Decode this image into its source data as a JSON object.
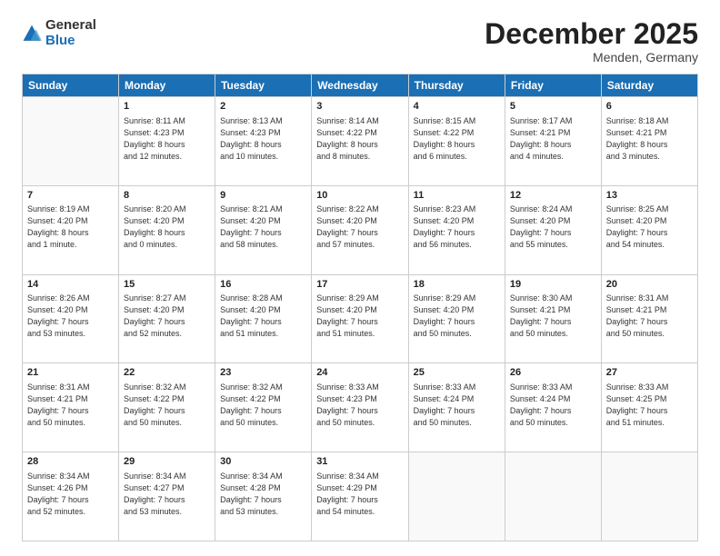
{
  "logo": {
    "general": "General",
    "blue": "Blue"
  },
  "header": {
    "month": "December 2025",
    "location": "Menden, Germany"
  },
  "weekdays": [
    "Sunday",
    "Monday",
    "Tuesday",
    "Wednesday",
    "Thursday",
    "Friday",
    "Saturday"
  ],
  "weeks": [
    [
      {
        "day": "",
        "info": ""
      },
      {
        "day": "1",
        "info": "Sunrise: 8:11 AM\nSunset: 4:23 PM\nDaylight: 8 hours\nand 12 minutes."
      },
      {
        "day": "2",
        "info": "Sunrise: 8:13 AM\nSunset: 4:23 PM\nDaylight: 8 hours\nand 10 minutes."
      },
      {
        "day": "3",
        "info": "Sunrise: 8:14 AM\nSunset: 4:22 PM\nDaylight: 8 hours\nand 8 minutes."
      },
      {
        "day": "4",
        "info": "Sunrise: 8:15 AM\nSunset: 4:22 PM\nDaylight: 8 hours\nand 6 minutes."
      },
      {
        "day": "5",
        "info": "Sunrise: 8:17 AM\nSunset: 4:21 PM\nDaylight: 8 hours\nand 4 minutes."
      },
      {
        "day": "6",
        "info": "Sunrise: 8:18 AM\nSunset: 4:21 PM\nDaylight: 8 hours\nand 3 minutes."
      }
    ],
    [
      {
        "day": "7",
        "info": "Sunrise: 8:19 AM\nSunset: 4:20 PM\nDaylight: 8 hours\nand 1 minute."
      },
      {
        "day": "8",
        "info": "Sunrise: 8:20 AM\nSunset: 4:20 PM\nDaylight: 8 hours\nand 0 minutes."
      },
      {
        "day": "9",
        "info": "Sunrise: 8:21 AM\nSunset: 4:20 PM\nDaylight: 7 hours\nand 58 minutes."
      },
      {
        "day": "10",
        "info": "Sunrise: 8:22 AM\nSunset: 4:20 PM\nDaylight: 7 hours\nand 57 minutes."
      },
      {
        "day": "11",
        "info": "Sunrise: 8:23 AM\nSunset: 4:20 PM\nDaylight: 7 hours\nand 56 minutes."
      },
      {
        "day": "12",
        "info": "Sunrise: 8:24 AM\nSunset: 4:20 PM\nDaylight: 7 hours\nand 55 minutes."
      },
      {
        "day": "13",
        "info": "Sunrise: 8:25 AM\nSunset: 4:20 PM\nDaylight: 7 hours\nand 54 minutes."
      }
    ],
    [
      {
        "day": "14",
        "info": "Sunrise: 8:26 AM\nSunset: 4:20 PM\nDaylight: 7 hours\nand 53 minutes."
      },
      {
        "day": "15",
        "info": "Sunrise: 8:27 AM\nSunset: 4:20 PM\nDaylight: 7 hours\nand 52 minutes."
      },
      {
        "day": "16",
        "info": "Sunrise: 8:28 AM\nSunset: 4:20 PM\nDaylight: 7 hours\nand 51 minutes."
      },
      {
        "day": "17",
        "info": "Sunrise: 8:29 AM\nSunset: 4:20 PM\nDaylight: 7 hours\nand 51 minutes."
      },
      {
        "day": "18",
        "info": "Sunrise: 8:29 AM\nSunset: 4:20 PM\nDaylight: 7 hours\nand 50 minutes."
      },
      {
        "day": "19",
        "info": "Sunrise: 8:30 AM\nSunset: 4:21 PM\nDaylight: 7 hours\nand 50 minutes."
      },
      {
        "day": "20",
        "info": "Sunrise: 8:31 AM\nSunset: 4:21 PM\nDaylight: 7 hours\nand 50 minutes."
      }
    ],
    [
      {
        "day": "21",
        "info": "Sunrise: 8:31 AM\nSunset: 4:21 PM\nDaylight: 7 hours\nand 50 minutes."
      },
      {
        "day": "22",
        "info": "Sunrise: 8:32 AM\nSunset: 4:22 PM\nDaylight: 7 hours\nand 50 minutes."
      },
      {
        "day": "23",
        "info": "Sunrise: 8:32 AM\nSunset: 4:22 PM\nDaylight: 7 hours\nand 50 minutes."
      },
      {
        "day": "24",
        "info": "Sunrise: 8:33 AM\nSunset: 4:23 PM\nDaylight: 7 hours\nand 50 minutes."
      },
      {
        "day": "25",
        "info": "Sunrise: 8:33 AM\nSunset: 4:24 PM\nDaylight: 7 hours\nand 50 minutes."
      },
      {
        "day": "26",
        "info": "Sunrise: 8:33 AM\nSunset: 4:24 PM\nDaylight: 7 hours\nand 50 minutes."
      },
      {
        "day": "27",
        "info": "Sunrise: 8:33 AM\nSunset: 4:25 PM\nDaylight: 7 hours\nand 51 minutes."
      }
    ],
    [
      {
        "day": "28",
        "info": "Sunrise: 8:34 AM\nSunset: 4:26 PM\nDaylight: 7 hours\nand 52 minutes."
      },
      {
        "day": "29",
        "info": "Sunrise: 8:34 AM\nSunset: 4:27 PM\nDaylight: 7 hours\nand 53 minutes."
      },
      {
        "day": "30",
        "info": "Sunrise: 8:34 AM\nSunset: 4:28 PM\nDaylight: 7 hours\nand 53 minutes."
      },
      {
        "day": "31",
        "info": "Sunrise: 8:34 AM\nSunset: 4:29 PM\nDaylight: 7 hours\nand 54 minutes."
      },
      {
        "day": "",
        "info": ""
      },
      {
        "day": "",
        "info": ""
      },
      {
        "day": "",
        "info": ""
      }
    ]
  ]
}
